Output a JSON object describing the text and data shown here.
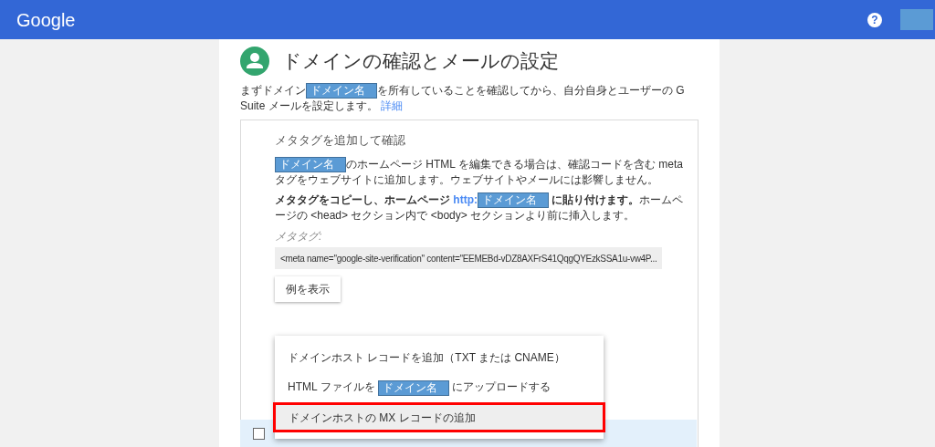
{
  "header": {
    "logo": "Google",
    "help": "?"
  },
  "title": "ドメインの確認とメールの設定",
  "intro": {
    "before": "まずドメイン",
    "domain": "ドメイン名",
    "after": "を所有していることを確認してから、自分自身とユーザーの G Suite メールを設定します。",
    "link": "詳細"
  },
  "method": {
    "title": "メタタグを追加して確認",
    "para1": {
      "domain": "ドメイン名",
      "after": "のホームページ HTML を編集できる場合は、確認コードを含む meta タグをウェブサイトに追加します。ウェブサイトやメールには影響しません。"
    },
    "para2": {
      "bold_before": "メタタグをコピーし、ホームページ",
      "link": "http:",
      "domain": "ドメイン名",
      "bold_after": "に貼り付けます。",
      "after": "ホームページの <head> セクション内で <body> セクションより前に挿入します。"
    },
    "meta_label": "メタタグ:",
    "meta_value": "<meta name=\"google-site-verification\" content=\"EEMEBd-vDZ8AXFrS41QqgQYEzkSSA1u-vw4P...",
    "example_button": "例を表示"
  },
  "menu": [
    {
      "kind": "text",
      "label": "ドメインホスト レコードを追加（TXT または CNAME）",
      "selected": false
    },
    {
      "kind": "domain",
      "before": "HTML ファイルを",
      "domain": "ドメイン名",
      "after": "にアップロードする",
      "selected": false
    },
    {
      "kind": "text",
      "label": "ドメインホストの MX レコードの追加",
      "selected": true
    }
  ],
  "confirm": {
    "checked": false
  }
}
